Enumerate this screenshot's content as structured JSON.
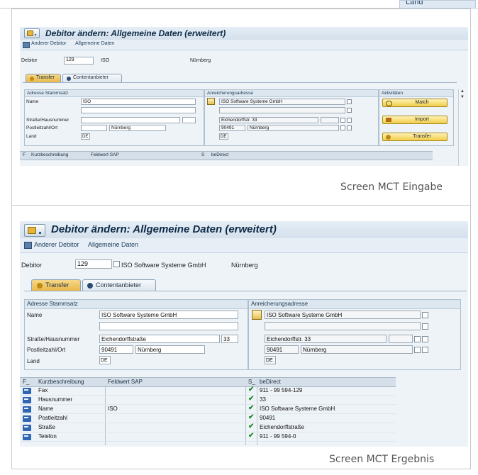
{
  "corner": {
    "label": "Land"
  },
  "screen1": {
    "title": "Debitor ändern: Allgemeine Daten (erweitert)",
    "toolbar": {
      "other_debtor": "Anderer Debitor",
      "general_data": "Allgemeine Daten"
    },
    "debtor_label": "Debitor",
    "debtor_value": "129",
    "debtor_short": "ISO",
    "debtor_city": "Nürnberg",
    "tabs": [
      "Transfer",
      "Contentanbieter"
    ],
    "master_group": {
      "header": "Adresse Stammsatz",
      "name_label": "Name",
      "name_value": "ISO",
      "street_label": "Straße/Hausnummer",
      "zip_label": "Postleitzahl/Ort",
      "city_value": "Nürnberg",
      "country_label": "Land",
      "country_value": "DE"
    },
    "enrich_group": {
      "header": "Anreicherungsadresse",
      "name_value": "ISO Software Systeme GmbH",
      "street_value": "Eichendorffstr. 33",
      "zip_value": "90491",
      "city_value": "Nürnberg",
      "country_value": "DE"
    },
    "activities": {
      "header": "Aktivitäten",
      "match": "Match",
      "import": "Import",
      "transfer": "Transfer"
    },
    "grid_headers": {
      "f": "F",
      "short": "Kurzbeschreibung",
      "sap": "Feldwert SAP",
      "s": "S",
      "bedirect": "beDirect"
    }
  },
  "caption1": "Screen MCT Eingabe",
  "screen2": {
    "title": "Debitor ändern: Allgemeine Daten (erweitert)",
    "toolbar": {
      "other_debtor": "Anderer Debitor",
      "general_data": "Allgemeine Daten"
    },
    "debtor_label": "Debitor",
    "debtor_value": "129",
    "debtor_name": "ISO Software Systeme GmbH",
    "debtor_city": "Nürnberg",
    "tabs": [
      "Transfer",
      "Contentanbieter"
    ],
    "master_group": {
      "header": "Adresse Stammsatz",
      "name_label": "Name",
      "name_value": "ISO Software Systeme GmbH",
      "street_label": "Straße/Hausnummer",
      "street_value": "Eichendorffstraße",
      "house_value": "33",
      "zip_label": "Postleitzahl/Ort",
      "zip_value": "90491",
      "city_value": "Nürnberg",
      "country_label": "Land",
      "country_value": "DE"
    },
    "enrich_group": {
      "header": "Anreicherungsadresse",
      "name_value": "ISO Software Systeme GmbH",
      "street_value": "Eichendorffstr. 33",
      "zip_value": "90491",
      "city_value": "Nürnberg",
      "country_value": "DE"
    },
    "grid_headers": {
      "f": "F_",
      "short": "Kurzbeschreibung",
      "sap": "Feldwert SAP",
      "s": "S_",
      "bedirect": "beDirect"
    },
    "grid_rows": [
      {
        "short": "Fax",
        "sap": "",
        "bedirect": "911 - 99 594-129"
      },
      {
        "short": "Hausnummer",
        "sap": "",
        "bedirect": "33"
      },
      {
        "short": "Name",
        "sap": "ISO",
        "bedirect": "ISO Software Systeme GmbH"
      },
      {
        "short": "Postleitzahl",
        "sap": "",
        "bedirect": "90491"
      },
      {
        "short": "Straße",
        "sap": "",
        "bedirect": "Eichendorffstraße"
      },
      {
        "short": "Telefon",
        "sap": "",
        "bedirect": "911 - 99 594-0"
      }
    ]
  },
  "caption2": "Screen MCT Ergebnis"
}
